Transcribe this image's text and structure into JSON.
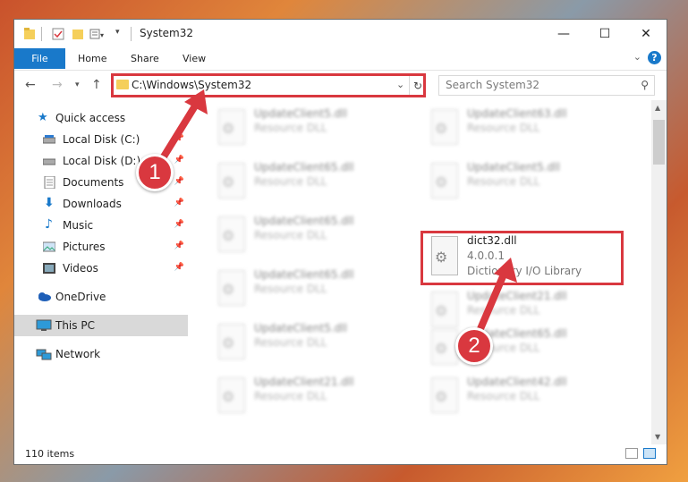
{
  "window": {
    "title": "System32",
    "minimize": "—",
    "maximize": "☐",
    "close": "✕"
  },
  "ribbon": {
    "tabs": [
      "File",
      "Home",
      "Share",
      "View"
    ],
    "help": "?"
  },
  "nav": {
    "address": "C:\\Windows\\System32",
    "search_placeholder": "Search System32"
  },
  "sidebar": {
    "items": [
      {
        "label": "Quick access",
        "icon": "star-icon",
        "pinned": false
      },
      {
        "label": "Local Disk (C:)",
        "icon": "drive-icon",
        "pinned": true
      },
      {
        "label": "Local Disk (D:)",
        "icon": "drive-icon",
        "pinned": true
      },
      {
        "label": "Documents",
        "icon": "documents-icon",
        "pinned": true
      },
      {
        "label": "Downloads",
        "icon": "download-icon",
        "pinned": true
      },
      {
        "label": "Music",
        "icon": "music-icon",
        "pinned": true
      },
      {
        "label": "Pictures",
        "icon": "pictures-icon",
        "pinned": true
      },
      {
        "label": "Videos",
        "icon": "videos-icon",
        "pinned": true
      },
      {
        "label": "OneDrive",
        "icon": "cloud-icon",
        "pinned": false
      },
      {
        "label": "This PC",
        "icon": "computer-icon",
        "pinned": false,
        "selected": true
      },
      {
        "label": "Network",
        "icon": "network-icon",
        "pinned": false
      }
    ]
  },
  "files": [
    {
      "name": "UpdateClient5.dll",
      "type": "Resource DLL"
    },
    {
      "name": "UpdateClient63.dll",
      "type": "Resource DLL"
    },
    {
      "name": "UpdateClient65.dll",
      "type": "Resource DLL"
    },
    {
      "name": "UpdateClient5.dll",
      "type": "Resource DLL"
    },
    {
      "name": "UpdateClient65.dll",
      "type": "Resource DLL"
    },
    {
      "name": "dict32.dll",
      "version": "4.0.0.1",
      "type": "Dictionary I/O Library",
      "highlighted": true
    },
    {
      "name": "UpdateClient65.dll",
      "type": "Resource DLL"
    },
    {
      "name": "UpdateClient21.dll",
      "type": "Resource DLL"
    },
    {
      "name": "UpdateClient5.dll",
      "type": "Resource DLL"
    },
    {
      "name": "UpdateClient65.dll",
      "type": "Resource DLL"
    },
    {
      "name": "UpdateClient21.dll",
      "type": "Resource DLL"
    },
    {
      "name": "UpdateClient42.dll",
      "type": "Resource DLL"
    }
  ],
  "status": {
    "item_count": "110 items"
  },
  "callouts": [
    "1",
    "2"
  ],
  "colors": {
    "accent": "#1979ca",
    "highlight": "#d9383f"
  }
}
